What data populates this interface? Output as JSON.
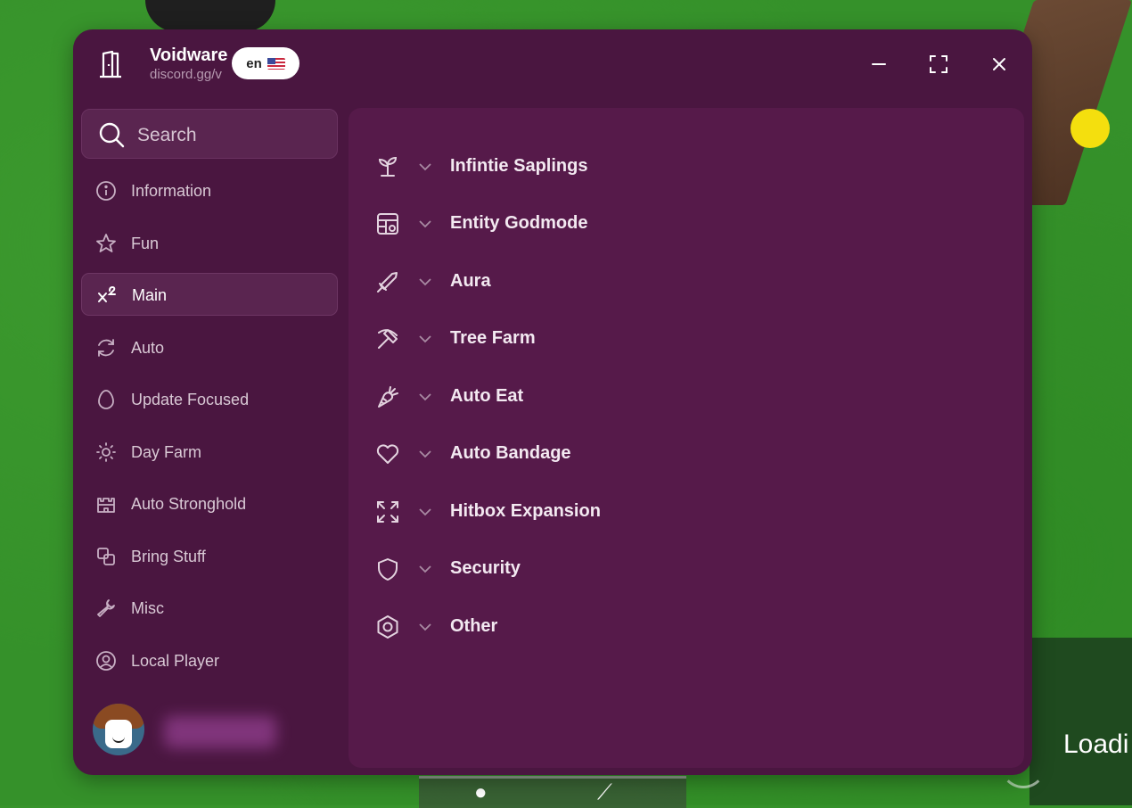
{
  "window": {
    "title": "Voidware",
    "subtitle": "discord.gg/v",
    "language": "en"
  },
  "sidebar": {
    "search_placeholder": "Search",
    "items": [
      {
        "label": "Information",
        "icon": "info-icon"
      },
      {
        "label": "Fun",
        "icon": "star-icon"
      },
      {
        "label": "Main",
        "icon": "superscript-icon",
        "active": true
      },
      {
        "label": "Auto",
        "icon": "refresh-icon"
      },
      {
        "label": "Update Focused",
        "icon": "egg-icon"
      },
      {
        "label": "Day Farm",
        "icon": "sun-icon"
      },
      {
        "label": "Auto Stronghold",
        "icon": "castle-icon"
      },
      {
        "label": "Bring Stuff",
        "icon": "link-squares-icon"
      },
      {
        "label": "Misc",
        "icon": "wrench-icon"
      },
      {
        "label": "Local Player",
        "icon": "user-circle-icon"
      }
    ]
  },
  "main": {
    "sections": [
      {
        "label": "Infintie Saplings",
        "icon": "sprout-icon"
      },
      {
        "label": "Entity Godmode",
        "icon": "layout-icon"
      },
      {
        "label": "Aura",
        "icon": "sword-icon"
      },
      {
        "label": "Tree Farm",
        "icon": "pickaxe-icon"
      },
      {
        "label": "Auto Eat",
        "icon": "carrot-icon"
      },
      {
        "label": "Auto Bandage",
        "icon": "heart-icon"
      },
      {
        "label": "Hitbox Expansion",
        "icon": "expand-icon"
      },
      {
        "label": "Security",
        "icon": "shield-icon"
      },
      {
        "label": "Other",
        "icon": "hexagon-icon"
      }
    ]
  },
  "game": {
    "loading_text": "Loadi"
  },
  "colors": {
    "window_bg": "#4a1640",
    "content_bg": "#561a4a",
    "active_item_bg": "#5a2550",
    "grass": "#35912a"
  }
}
